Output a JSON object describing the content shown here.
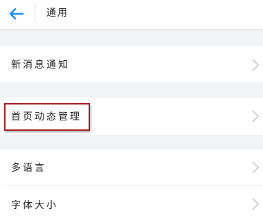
{
  "header": {
    "back_icon": "arrow-left-icon",
    "title": "通用"
  },
  "settings": {
    "notification": {
      "label": "新消息通知"
    },
    "home_feed": {
      "label": "首页动态管理"
    },
    "language": {
      "label": "多语言"
    },
    "font_size": {
      "label": "字体大小"
    }
  },
  "colors": {
    "accent": "#1a8cff",
    "background": "#f2f3f4",
    "row": "#ffffff",
    "highlight": "#a61d22",
    "chevron": "#c8c8c8"
  }
}
